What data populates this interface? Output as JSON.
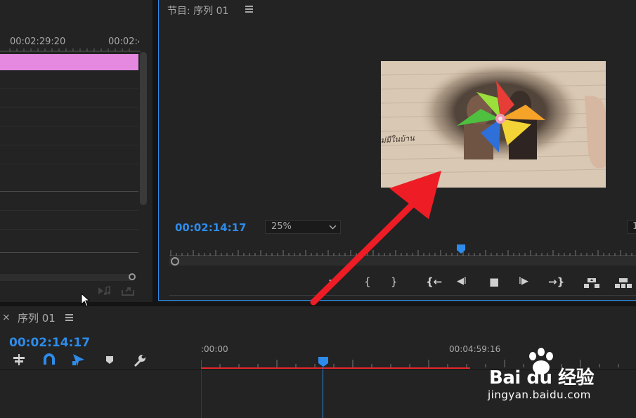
{
  "left_panel": {
    "ruler_time_1": "00:02:29:20",
    "ruler_time_2": "00:02:4"
  },
  "program_monitor": {
    "title": "节目: 序列 01",
    "menu_icon": "hamburger-icon",
    "timecode": "00:02:14:17",
    "zoom": "25%",
    "right_cut_value": "1",
    "playhead_fraction": 0.6
  },
  "video_frame": {
    "handwriting": "ไม่มีในบ้าน"
  },
  "transport": {
    "buttons": [
      {
        "name": "add-marker-button",
        "glyph": "▼"
      },
      {
        "name": "mark-in-button",
        "glyph": "{"
      },
      {
        "name": "mark-out-button",
        "glyph": "}"
      },
      {
        "name": "go-to-in-button",
        "glyph": "{←"
      },
      {
        "name": "step-back-button",
        "glyph": "◀I"
      },
      {
        "name": "stop-button",
        "glyph": "■"
      },
      {
        "name": "step-forward-button",
        "glyph": "I▶"
      },
      {
        "name": "go-to-out-button",
        "glyph": "→}"
      },
      {
        "name": "lift-button",
        "glyph": "lift"
      },
      {
        "name": "extract-button",
        "glyph": "extract"
      }
    ]
  },
  "timeline": {
    "close_glyph": "×",
    "title": "序列 01",
    "timecode": "00:02:14:17",
    "ruler_start": ":00:00",
    "ruler_mid": "00:04:59:16",
    "tools": [
      "snap-icon",
      "magnet-icon",
      "linked-select-icon",
      "marker-icon",
      "wrench-icon"
    ]
  },
  "watermark": {
    "brand": "Bai du 经验",
    "url": "jingyan.baidu.com"
  },
  "colors": {
    "accent_blue": "#2d8ceb",
    "clip_pink": "#e589e0",
    "arrow_red": "#ee1c25",
    "work_area_red": "#e8262a"
  }
}
